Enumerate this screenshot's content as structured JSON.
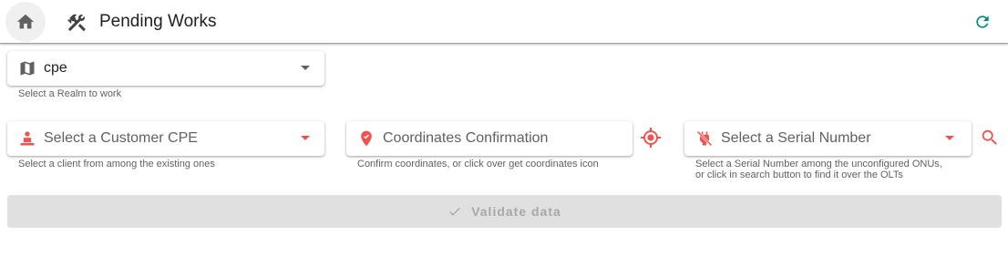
{
  "header": {
    "title": "Pending Works",
    "home_icon": "home-icon",
    "title_icon": "tools-icon",
    "refresh_icon": "refresh-icon"
  },
  "realm": {
    "value": "cpe",
    "icon": "map-icon",
    "hint": "Select a Realm to work"
  },
  "customer": {
    "placeholder": "Select a Customer CPE",
    "icon": "person-pin-icon",
    "hint": "Select a client from among the existing ones"
  },
  "coordinates": {
    "placeholder": "Coordinates Confirmation",
    "icon": "location-pin-icon",
    "hint": "Confirm coordinates, or click over get coordinates icon",
    "action_icon": "gps-fixed-icon"
  },
  "serial": {
    "placeholder": "Select a Serial Number",
    "icon": "power-off-icon",
    "hint_line1": "Select a Serial Number among the unconfigured ONUs,",
    "hint_line2": "or click in search button to find it over the OLTs",
    "action_icon": "search-icon"
  },
  "validate": {
    "label": "Validate data",
    "icon": "check-icon"
  },
  "colors": {
    "accent_red": "#ef5350",
    "accent_teal": "#00897b",
    "disabled_bg": "#e0e0e0",
    "disabled_text": "#a8a8a8"
  }
}
